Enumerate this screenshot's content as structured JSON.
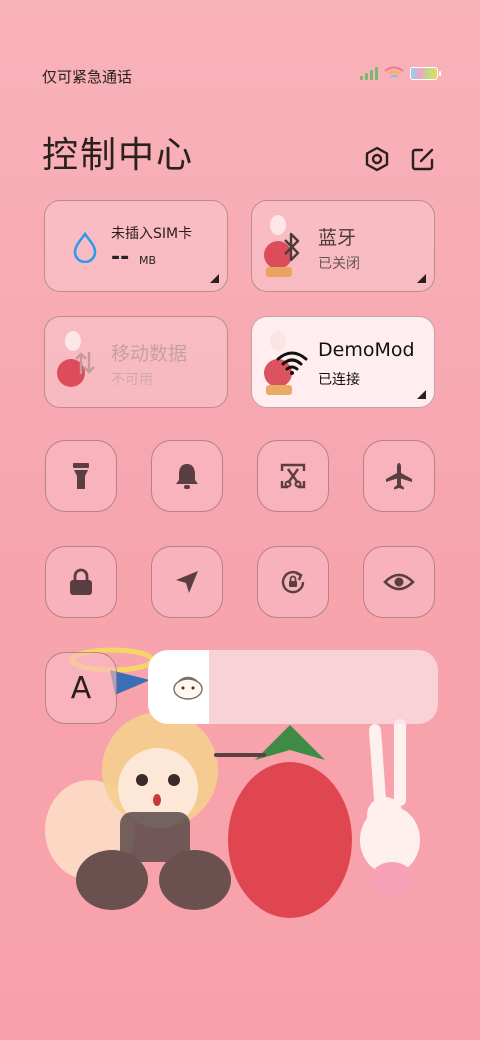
{
  "status_bar": {
    "carrier": "仅可紧急通话",
    "icons": [
      "signal-icon",
      "wifi-icon",
      "battery-icon"
    ]
  },
  "header": {
    "title": "控制中心",
    "settings_icon": "settings-icon",
    "edit_icon": "edit-icon"
  },
  "tiles": {
    "sim": {
      "label": "未插入SIM卡",
      "value": "--",
      "unit": "MB",
      "icon": "drop-icon"
    },
    "bluetooth": {
      "label": "蓝牙",
      "status": "已关闭",
      "icon": "bluetooth-icon"
    },
    "mobile_data": {
      "label": "移动数据",
      "status": "不可用",
      "icon": "mobile-data-icon"
    },
    "wifi": {
      "label": "DemoMod",
      "status": "已连接",
      "icon": "wifi-icon"
    }
  },
  "toggles_row1": [
    "flashlight-icon",
    "bell-icon",
    "screenshot-icon",
    "airplane-icon"
  ],
  "toggles_row2": [
    "lock-icon",
    "location-icon",
    "rotation-lock-icon",
    "eye-icon"
  ],
  "font_button": {
    "label": "A"
  },
  "brightness": {
    "level": 0.21
  },
  "colors": {
    "background": "#f7a4ad",
    "tile_on": "#fff3f4",
    "icon_dark": "#5a3e42",
    "accent_blue": "#2e9bf0"
  }
}
